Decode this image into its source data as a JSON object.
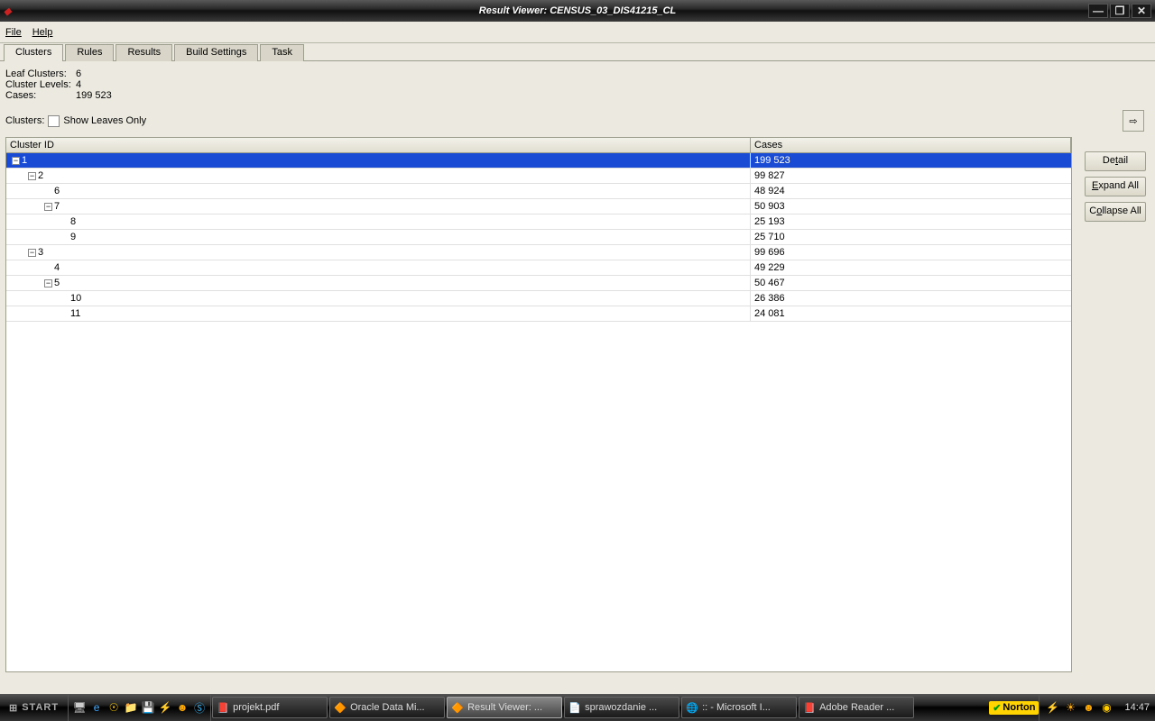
{
  "window_title": "Result Viewer: CENSUS_03_DIS41215_CL",
  "menu": {
    "file": "File",
    "help": "Help"
  },
  "tabs": [
    {
      "label": "Clusters",
      "active": true
    },
    {
      "label": "Rules",
      "active": false
    },
    {
      "label": "Results",
      "active": false
    },
    {
      "label": "Build Settings",
      "active": false
    },
    {
      "label": "Task",
      "active": false
    }
  ],
  "stats": {
    "leaf_label": "Leaf Clusters:",
    "leaf_val": "6",
    "levels_label": "Cluster Levels:",
    "levels_val": "4",
    "cases_label": "Cases:",
    "cases_val": "199 523"
  },
  "clusters_label": "Clusters:",
  "show_leaves": "Show Leaves Only",
  "columns": {
    "id": "Cluster ID",
    "cases": "Cases"
  },
  "rows": [
    {
      "indent": 0,
      "expander": "-",
      "id": "1",
      "cases": "199 523",
      "selected": true
    },
    {
      "indent": 1,
      "expander": "-",
      "id": "2",
      "cases": "99 827",
      "selected": false
    },
    {
      "indent": 2,
      "expander": "",
      "id": "6",
      "cases": "48 924",
      "selected": false
    },
    {
      "indent": 2,
      "expander": "-",
      "id": "7",
      "cases": "50 903",
      "selected": false
    },
    {
      "indent": 3,
      "expander": "",
      "id": "8",
      "cases": "25 193",
      "selected": false
    },
    {
      "indent": 3,
      "expander": "",
      "id": "9",
      "cases": "25 710",
      "selected": false
    },
    {
      "indent": 1,
      "expander": "-",
      "id": "3",
      "cases": "99 696",
      "selected": false
    },
    {
      "indent": 2,
      "expander": "",
      "id": "4",
      "cases": "49 229",
      "selected": false
    },
    {
      "indent": 2,
      "expander": "-",
      "id": "5",
      "cases": "50 467",
      "selected": false
    },
    {
      "indent": 3,
      "expander": "",
      "id": "10",
      "cases": "26 386",
      "selected": false
    },
    {
      "indent": 3,
      "expander": "",
      "id": "11",
      "cases": "24 081",
      "selected": false
    }
  ],
  "buttons": {
    "detail": "Detail",
    "expand": "Expand All",
    "collapse": "Collapse All"
  },
  "taskbar": {
    "start": "START",
    "items": [
      {
        "icon": "📕",
        "label": "projekt.pdf",
        "active": false
      },
      {
        "icon": "🔶",
        "label": "Oracle Data Mi...",
        "active": false
      },
      {
        "icon": "🔶",
        "label": "Result Viewer: ...",
        "active": true
      },
      {
        "icon": "📄",
        "label": "sprawozdanie ...",
        "active": false
      },
      {
        "icon": "🌐",
        "label": ":: - Microsoft I...",
        "active": false
      },
      {
        "icon": "📕",
        "label": "Adobe Reader ...",
        "active": false
      }
    ],
    "norton": "Norton",
    "clock": "14:47"
  }
}
